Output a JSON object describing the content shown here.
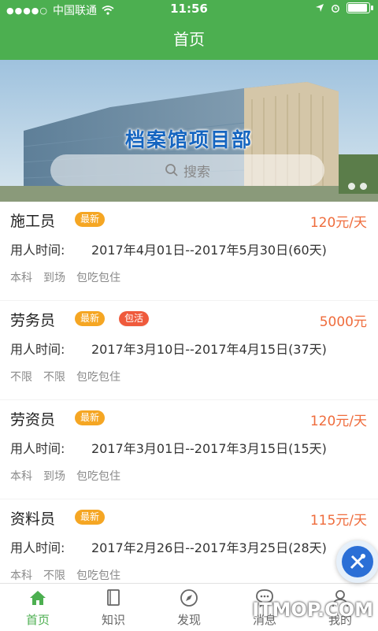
{
  "status_bar": {
    "signal": "●●●●○",
    "carrier": "中国联通",
    "time": "11:56",
    "icons": [
      "signal-icon",
      "wifi-icon",
      "location-icon",
      "alarm-icon",
      "battery-icon"
    ],
    "battery_level": 0.85
  },
  "header": {
    "title": "首页"
  },
  "banner": {
    "title": "档案馆项目部",
    "search_placeholder": "搜索",
    "pager_count": 2
  },
  "jobs": [
    {
      "title": "施工员",
      "tags": [
        {
          "label": "最新",
          "kind": "new"
        }
      ],
      "price": "120元/天",
      "time_label": "用人时间:",
      "time_value": "2017年4月01日--2017年5月30日(60天)",
      "conditions": [
        "本科",
        "到场",
        "包吃包住"
      ]
    },
    {
      "title": "劳务员",
      "tags": [
        {
          "label": "最新",
          "kind": "new"
        },
        {
          "label": "包活",
          "kind": "job"
        }
      ],
      "price": "5000元",
      "time_label": "用人时间:",
      "time_value": "2017年3月10日--2017年4月15日(37天)",
      "conditions": [
        "不限",
        "不限",
        "包吃包住"
      ]
    },
    {
      "title": "劳资员",
      "tags": [
        {
          "label": "最新",
          "kind": "new"
        }
      ],
      "price": "120元/天",
      "time_label": "用人时间:",
      "time_value": "2017年3月01日--2017年3月15日(15天)",
      "conditions": [
        "本科",
        "到场",
        "包吃包住"
      ]
    },
    {
      "title": "资料员",
      "tags": [
        {
          "label": "最新",
          "kind": "new"
        }
      ],
      "price": "115元/天",
      "time_label": "用人时间:",
      "time_value": "2017年2月26日--2017年3月25日(28天)",
      "conditions": [
        "本科",
        "不限",
        "包吃包住"
      ]
    }
  ],
  "tabbar": {
    "items": [
      {
        "label": "首页",
        "icon": "home-icon",
        "active": true
      },
      {
        "label": "知识",
        "icon": "book-icon",
        "active": false
      },
      {
        "label": "发现",
        "icon": "compass-icon",
        "active": false
      },
      {
        "label": "消息",
        "icon": "message-icon",
        "active": false
      },
      {
        "label": "我的",
        "icon": "user-icon",
        "active": false
      }
    ]
  },
  "watermark": "ITMOP.COM",
  "colors": {
    "primary": "#4caf50",
    "price": "#ef6c3c",
    "tag_new": "#f5a623",
    "tag_job": "#ef5a3c"
  }
}
